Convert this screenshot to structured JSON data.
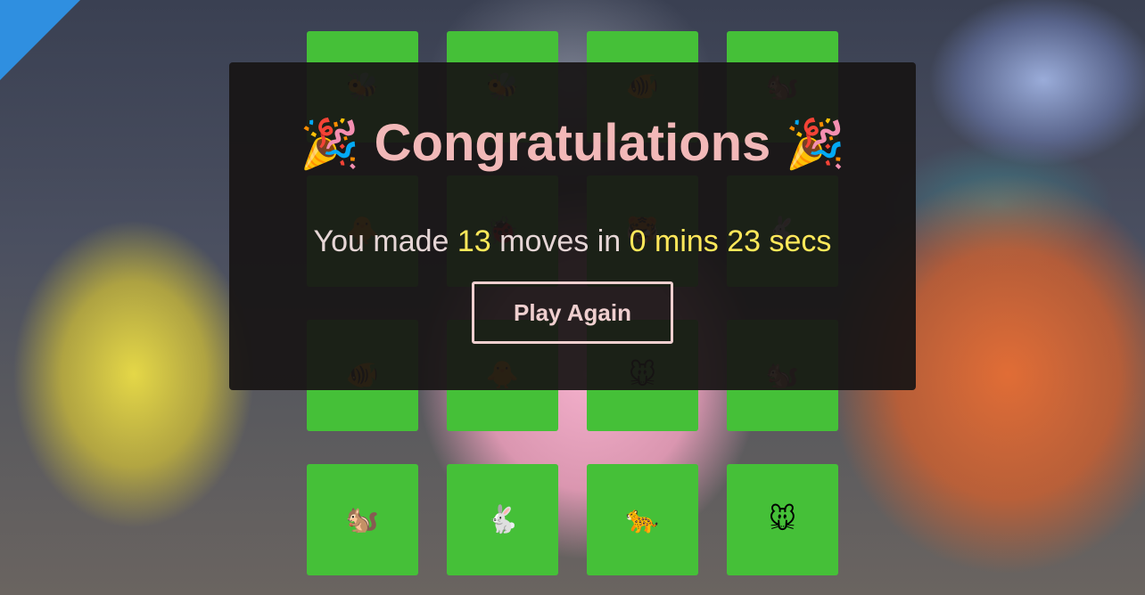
{
  "cards": [
    {
      "emoji": "🐝",
      "icon": "bee-icon"
    },
    {
      "emoji": "🐝",
      "icon": "bee-icon"
    },
    {
      "emoji": "🐠",
      "icon": "fish-icon"
    },
    {
      "emoji": "🐿️",
      "icon": "squirrel-icon"
    },
    {
      "emoji": "🐥",
      "icon": "chick-icon"
    },
    {
      "emoji": "🐞",
      "icon": "ladybug-icon"
    },
    {
      "emoji": "🐯",
      "icon": "tiger-icon"
    },
    {
      "emoji": "🐇",
      "icon": "rabbit-icon"
    },
    {
      "emoji": "🐠",
      "icon": "fish-icon"
    },
    {
      "emoji": "🐥",
      "icon": "chick-icon"
    },
    {
      "emoji": "🐭",
      "icon": "mouse-icon"
    },
    {
      "emoji": "🐿️",
      "icon": "squirrel-icon"
    },
    {
      "emoji": "🐿️",
      "icon": "squirrel-icon"
    },
    {
      "emoji": "🐇",
      "icon": "rabbit-icon"
    },
    {
      "emoji": "🐆",
      "icon": "leopard-icon"
    },
    {
      "emoji": "🐭",
      "icon": "mouse-icon"
    }
  ],
  "colors": {
    "card": "#45c038",
    "title": "#f2b8b8",
    "highlight": "#ffe85a"
  },
  "modal": {
    "party_left": "🎉",
    "title": "Congratulations",
    "party_right": "🎉",
    "stats": {
      "prefix": "You made ",
      "moves": "13",
      "moves_label": " moves in ",
      "mins": "0 mins",
      "secs": "23 secs"
    },
    "button_label": "Play Again"
  }
}
